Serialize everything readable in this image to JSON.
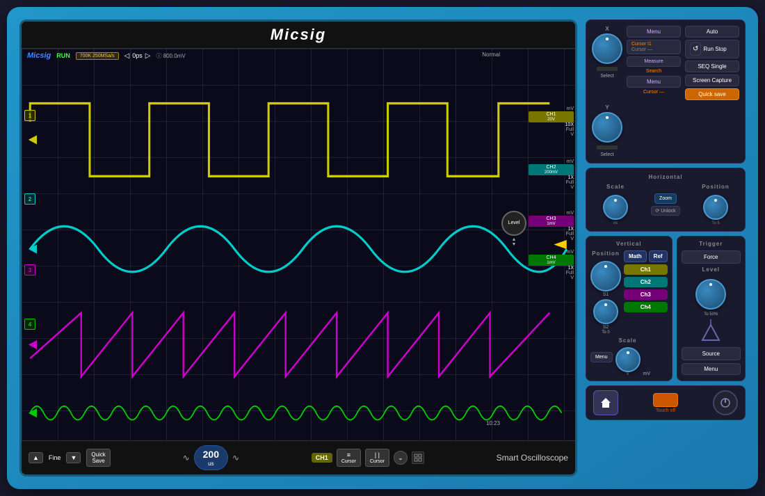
{
  "app": {
    "title": "Micsig",
    "subtitle": "Smart Oscilloscope"
  },
  "screen": {
    "brand": "Micsig",
    "status": "RUN",
    "timebase": "700K\n250MSa/s",
    "offset": "0ps",
    "trigger_voltage": "800.0mV",
    "normal_label": "Normal",
    "timestamp": "10:23",
    "time_division": "200",
    "time_unit": "us",
    "channel_badge": "CH1"
  },
  "channels": [
    {
      "id": "CH1",
      "color": "#cccc00",
      "scale": "20V",
      "probe": "10X",
      "coupling": "Full",
      "mv_top": "mV",
      "mv_bot": "V",
      "marker": "1"
    },
    {
      "id": "CH2",
      "color": "#00cccc",
      "scale": "200mV",
      "probe": "1X",
      "coupling": "Full",
      "mv_top": "mV",
      "mv_bot": "V",
      "marker": "2"
    },
    {
      "id": "CH3",
      "color": "#cc00cc",
      "scale": "1mV",
      "probe": "1X",
      "coupling": "Full",
      "mv_top": "mV",
      "mv_bot": "V",
      "marker": "3"
    },
    {
      "id": "CH4",
      "color": "#00cc00",
      "scale": "1mV",
      "probe": "1X",
      "coupling": "Full",
      "mv_top": "mV",
      "mv_bot": "V",
      "marker": "4"
    }
  ],
  "bottom_bar": {
    "fine_label": "Fine",
    "quick_save": "Quick\nSave",
    "cursor_label": "Cursor",
    "cursor2_label": "Cursor"
  },
  "right_panel": {
    "x_label": "X",
    "y_label": "Y",
    "menu_label": "Menu",
    "cursor_i1": "Cursor I1",
    "auto_btn": "Auto",
    "run_stop_btn": "Run\nStop",
    "seq_single_btn": "SEQ\nSingle",
    "screen_capture_btn": "Screen\nCapture",
    "quick_save_btn": "Quick save",
    "measure_label": "Measure",
    "search_label": "Search",
    "cursor_dash": "Cursor —",
    "menu_btn2": "Menu",
    "select_label": "Select",
    "horizontal_label": "Horizontal",
    "scale_label": "Scale",
    "position_label": "Position",
    "zoom_label": "Zoom",
    "unlock_label": "⟳ Unlock",
    "ns_label": "ns",
    "to5_label": "To 5",
    "vertical_label": "Vertical",
    "trigger_label": "Trigger",
    "position_v_label": "Position",
    "s1_label": "S1",
    "s2_label": "S2",
    "to0_label": "To 0",
    "math_btn": "Math",
    "ref_btn": "Ref",
    "ch1_btn": "Ch1",
    "ch2_btn": "Ch2",
    "ch3_btn": "Ch3",
    "ch4_btn": "Ch4",
    "menu_v_btn": "Menu",
    "scale_v_label": "Scale",
    "v_label": "V",
    "mv_label": "mV",
    "force_btn": "Force",
    "level_label": "Level",
    "to50_label": "To 50%",
    "source_btn": "Source",
    "menu_t_btn": "Menu",
    "touch_off": "Touch off"
  }
}
